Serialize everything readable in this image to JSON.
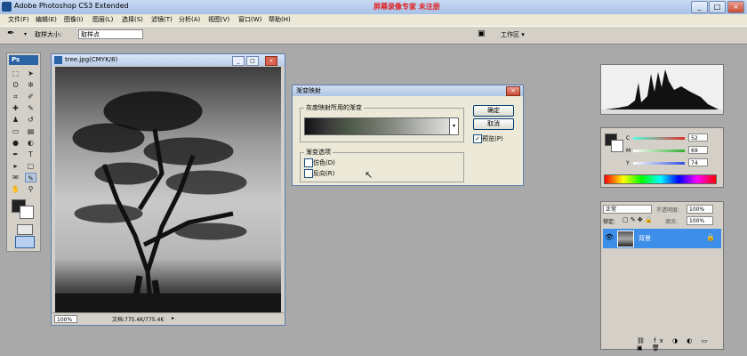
{
  "app": {
    "title": "Adobe Photoshop CS3 Extended",
    "watermark": "屏幕录像专家  未注册"
  },
  "window_controls": {
    "minimize": "_",
    "maximize": "□",
    "close": "×"
  },
  "menu": [
    "文件(F)",
    "编辑(E)",
    "图像(I)",
    "图层(L)",
    "选择(S)",
    "滤镜(T)",
    "分析(A)",
    "视图(V)",
    "窗口(W)",
    "帮助(H)"
  ],
  "options_bar": {
    "sample_size_label": "取样大小:",
    "sample_size_value": "取样点",
    "workspace_label": "工作区 ▾"
  },
  "tools_panel": {
    "logo": "Ps"
  },
  "document": {
    "title": "tree.jpg(CMYK/8)",
    "zoom": "100%",
    "doc_info": "文档:775.4K/775.4K"
  },
  "dialog": {
    "title": "渐变映射",
    "group_gradient_label": "灰度映射所用的渐变",
    "gradient_colors": [
      "#111111",
      "#e8e8e6"
    ],
    "ok_label": "确定",
    "cancel_label": "取消",
    "preview_label": "预览(P)",
    "preview_checked": true,
    "options_group_label": "渐变选项",
    "dither_label": "仿色(D)",
    "reverse_label": "反向(R)"
  },
  "color_panel": {
    "channels": [
      {
        "label": "C",
        "value": "52",
        "color": "#e03030"
      },
      {
        "label": "M",
        "value": "69",
        "color": "#30b030"
      },
      {
        "label": "Y",
        "value": "74",
        "color": "#3050e0"
      }
    ]
  },
  "layers_panel": {
    "blend_mode": "正常",
    "opacity_label": "不透明度:",
    "opacity_value": "100%",
    "lock_label": "锁定:",
    "fill_label": "填充:",
    "fill_value": "100%",
    "layer_name": "背景"
  }
}
